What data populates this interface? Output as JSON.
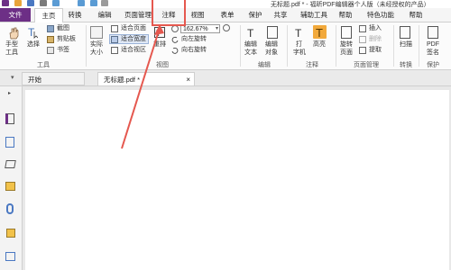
{
  "window": {
    "title": "无标题.pdf * - 福昕PDF编辑器个人版（未经授权的产品）"
  },
  "tabs": [
    "文件",
    "主页",
    "转换",
    "编辑",
    "页面管理",
    "注释",
    "视图",
    "表单",
    "保护",
    "共享",
    "辅助工具",
    "帮助",
    "特色功能",
    "帮助"
  ],
  "ribbon": {
    "hand_tool": [
      "手型",
      "工具"
    ],
    "select": "选择",
    "screenshot": "截图",
    "clipboard": "剪贴板",
    "bookmark": "书签",
    "tools_group": "工具",
    "actual_size": [
      "实际",
      "大小"
    ],
    "fit_page": "适合页面",
    "fit_width": "适合宽度",
    "fit_visible": "适合视区",
    "view_group": "视图",
    "zoom_value": "162.67%",
    "rotate_left": "向左旋转",
    "rotate_right": "向右旋转",
    "reflow": "重排",
    "edit_text": [
      "编辑",
      "文本"
    ],
    "edit_object": [
      "编辑",
      "对象"
    ],
    "edit_group": "编辑",
    "typewriter": [
      "打",
      "字机"
    ],
    "highlight": "高亮",
    "annot_group": "注释",
    "rotate_page": [
      "旋转",
      "页面"
    ],
    "insert": "插入",
    "delete": "删除",
    "extract": "提取",
    "page_group": "页面管理",
    "scan": "扫描",
    "convert_group": "转换",
    "pdf_sign": [
      "PDF",
      "签名"
    ],
    "protect_group": "保护"
  },
  "doc_tabs": {
    "start": "开始",
    "file": "无标题.pdf *"
  },
  "colors": {
    "file_tab": "#6d2f86",
    "annotation_arrow": "#e5584f",
    "highlight_icon": "#f2a93b"
  }
}
